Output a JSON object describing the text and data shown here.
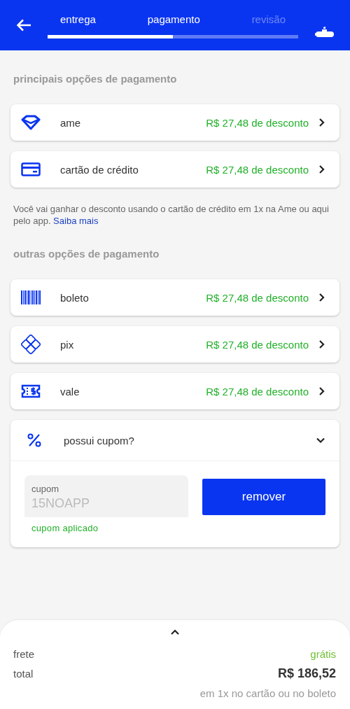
{
  "header": {
    "steps": [
      {
        "label": "entrega",
        "reached": true
      },
      {
        "label": "pagamento",
        "reached": true
      },
      {
        "label": "revisão",
        "reached": false
      }
    ],
    "progress": {
      "level": 0.5
    }
  },
  "sections": [
    {
      "title": "principais opções de pagamento",
      "options": [
        {
          "kind": "diamond",
          "label": "ame",
          "discount": "R$ 27,48 de desconto"
        },
        {
          "kind": "card",
          "label": "cartão de crédito",
          "discount": "R$ 27,48 de desconto"
        }
      ],
      "note": "Você vai ganhar o desconto usando o cartão de crédito em 1x na Ame ou aqui pelo app.",
      "note_link": "Saiba mais"
    },
    {
      "title": "outras opções de pagamento",
      "options": [
        {
          "kind": "barcode",
          "label": "boleto",
          "discount": "R$ 27,48 de desconto"
        },
        {
          "kind": "pix",
          "label": "pix",
          "discount": "R$ 27,48 de desconto"
        },
        {
          "kind": "voucher",
          "label": "vale",
          "discount": "R$ 27,48 de desconto"
        }
      ]
    }
  ],
  "coupon": {
    "title": "possui cupom?",
    "expanded": true,
    "field": {
      "label": "cupom",
      "value": "15NOAPP",
      "disabled": true
    },
    "status": "cupom aplicado",
    "button": "remover"
  },
  "summary": {
    "rows": [
      {
        "label": "frete",
        "value": "grátis",
        "kind": "free"
      },
      {
        "label": "total",
        "value": "R$ 186,52",
        "kind": "total"
      }
    ],
    "note": "em 1x no cartão ou no boleto"
  }
}
